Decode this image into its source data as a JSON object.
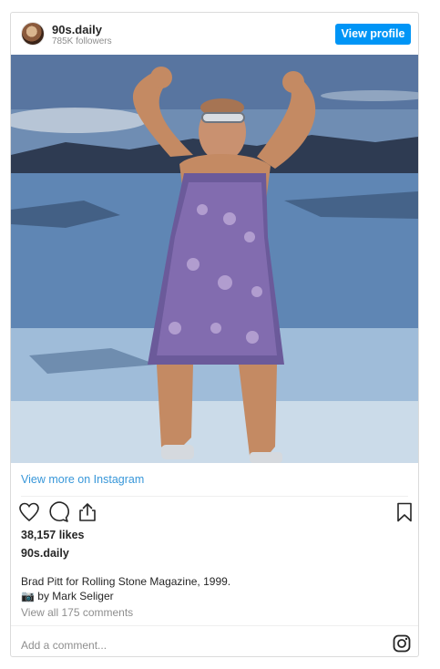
{
  "header": {
    "username": "90s.daily",
    "followers": "785K followers",
    "view_profile": "View profile"
  },
  "photo": {
    "description_icon": "image"
  },
  "view_more": "View more on Instagram",
  "likes": "38,157 likes",
  "owner": "90s.daily",
  "caption": {
    "line1": "Brad Pitt for Rolling Stone Magazine, 1999.",
    "line2_icon": "📷",
    "line2_text": " by Mark Seliger"
  },
  "comments_link": "View all 175 comments",
  "add_comment_placeholder": "Add a comment...",
  "colors": {
    "accent": "#0095f6",
    "link": "#3897d9",
    "muted": "#8e8e8e"
  }
}
